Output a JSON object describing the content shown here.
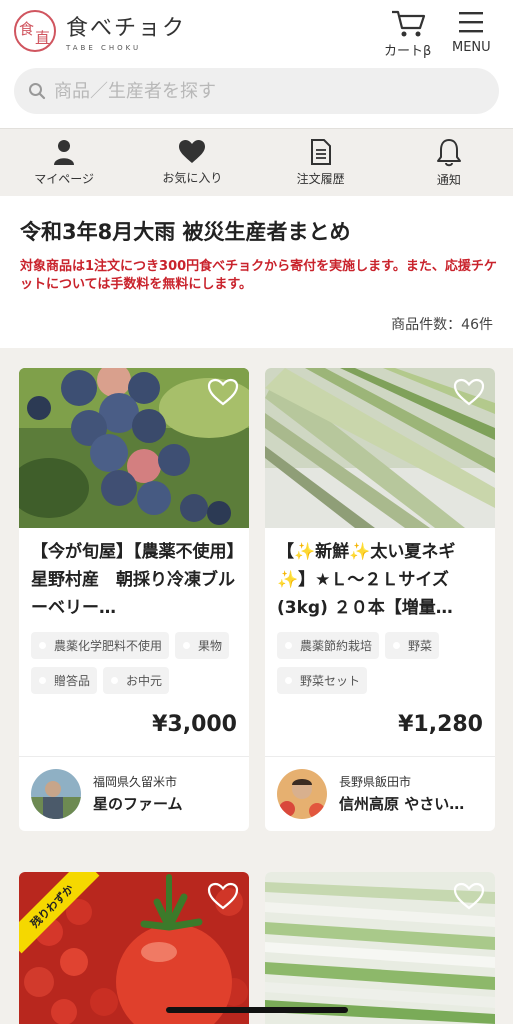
{
  "header": {
    "logo_text": "食べチョク",
    "logo_sub": "TABE CHOKU",
    "cart_label": "カートβ",
    "menu_label": "MENU"
  },
  "search": {
    "placeholder": "商品／生産者を探す"
  },
  "nav": {
    "items": [
      {
        "label": "マイページ",
        "icon": "person-icon"
      },
      {
        "label": "お気に入り",
        "icon": "heart-icon"
      },
      {
        "label": "注文履歴",
        "icon": "document-icon"
      },
      {
        "label": "通知",
        "icon": "bell-icon"
      }
    ]
  },
  "feature": {
    "title": "令和3年8月大雨 被災生産者まとめ",
    "notice": "対象商品は1注文につき300円食べチョクから寄付を実施します。また、応援チケットについては手数料を無料にします。",
    "count": "商品件数：46件"
  },
  "products": [
    {
      "title": "【今が旬屋】【農薬不使用】星野村産　朝採り冷凍ブルーベリー…",
      "tags": [
        "農薬化学肥料不使用",
        "果物",
        "贈答品",
        "お中元"
      ],
      "price": "¥3,000",
      "prefecture": "福岡県久留米市",
      "producer": "星のファーム"
    },
    {
      "title": "【✨新鮮✨太い夏ネギ✨】★Ｌ～２Ｌサイズ(3kg) ２０本【増量…",
      "tags": [
        "農薬節約栽培",
        "野菜",
        "野菜セット"
      ],
      "price": "¥1,280",
      "prefecture": "長野県飯田市",
      "producer": "信州高原 やさい…"
    },
    {
      "badge": "残りわずか"
    },
    {}
  ]
}
